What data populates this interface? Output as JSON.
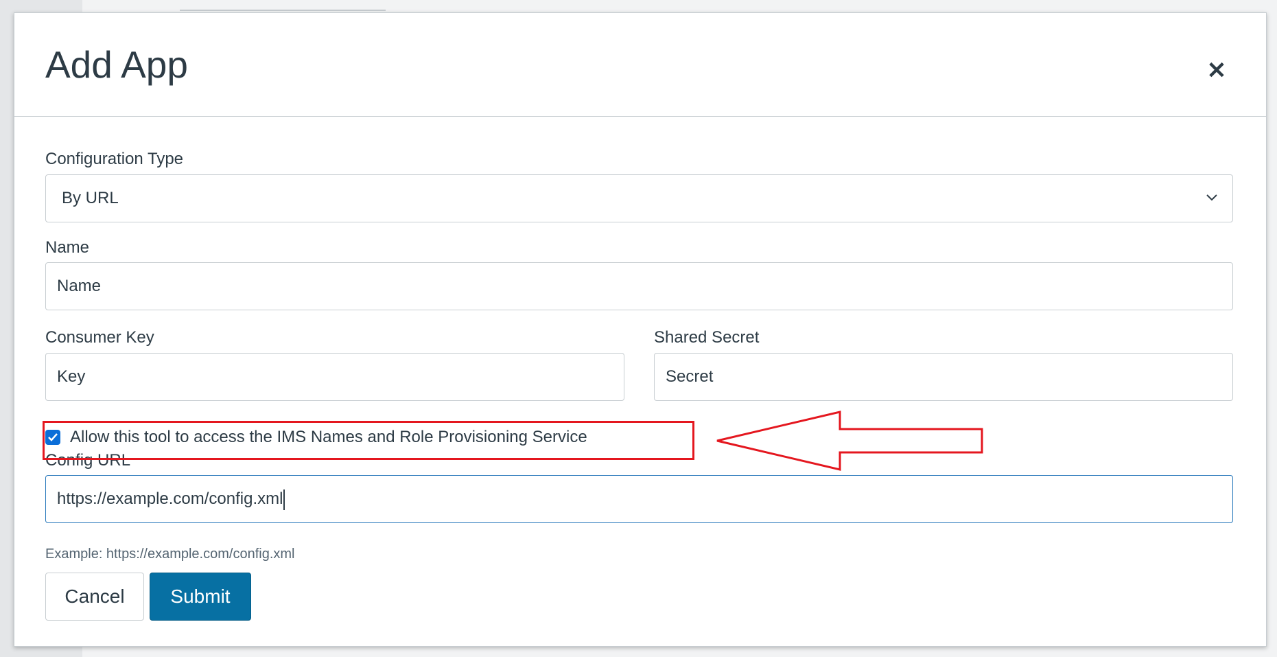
{
  "modal": {
    "title": "Add App",
    "close_icon": "close-icon"
  },
  "form": {
    "configuration_type": {
      "label": "Configuration Type",
      "value": "By URL"
    },
    "name": {
      "label": "Name",
      "placeholder": "Name"
    },
    "consumer_key": {
      "label": "Consumer Key",
      "placeholder": "Key"
    },
    "shared_secret": {
      "label": "Shared Secret",
      "placeholder": "Secret"
    },
    "ims_access": {
      "label": "Allow this tool to access the IMS Names and Role Provisioning Service",
      "checked": true
    },
    "config_url": {
      "label": "Config URL",
      "value": "https://example.com/config.xml",
      "hint": "Example: https://example.com/config.xml"
    }
  },
  "actions": {
    "cancel_label": "Cancel",
    "submit_label": "Submit"
  },
  "colors": {
    "submit_background": "#0770a3",
    "checkbox_checked": "#0b6ed8",
    "annotation_red": "#e4171f",
    "focus_border": "#2b7abc"
  }
}
